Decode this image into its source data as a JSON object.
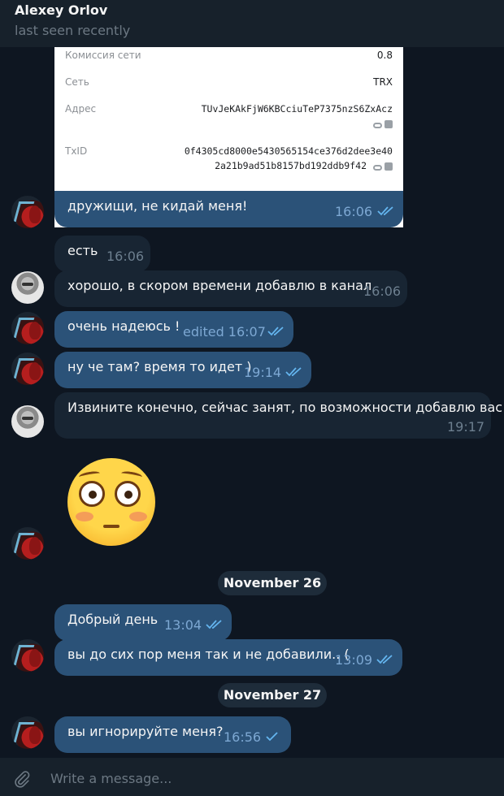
{
  "header": {
    "name": "Alexey Orlov",
    "status": "last seen recently"
  },
  "card": {
    "rows": [
      {
        "label": "Комиссия сети",
        "value": "0.8"
      },
      {
        "label": "Сеть",
        "value": "TRX"
      },
      {
        "label": "Адрес",
        "value": "TUvJeKAkFjW6KBCciuTeP7375nzS6ZxAcz"
      },
      {
        "label": "TxID",
        "value_line1": "0f4305cd8000e5430565154ce376d2dee3e40",
        "value_line2": "2a21b9ad51b8157bd192ddb9f42"
      }
    ]
  },
  "messages": [
    {
      "text": "дружищи, не кидай меня!",
      "time": "16:06",
      "dir": "out",
      "status": "read"
    },
    {
      "text": "есть",
      "time": "16:06",
      "dir": "in"
    },
    {
      "text": "хорошо, в скором времени добавлю в канал",
      "time": "16:06",
      "dir": "in"
    },
    {
      "text": "очень надеюсь !",
      "time": "edited 16:07",
      "dir": "out",
      "status": "read"
    },
    {
      "text": "ну че там? время то идет )",
      "time": "19:14",
      "dir": "out",
      "status": "read"
    },
    {
      "text": "Извините конечно, сейчас занят, по возможности добавлю вас",
      "time": "19:17",
      "dir": "in"
    },
    {
      "text": "Добрый день",
      "time": "13:04",
      "dir": "out",
      "status": "read"
    },
    {
      "text": "вы до сих пор меня так и не добавили.. (",
      "time": "13:09",
      "dir": "out",
      "status": "read"
    },
    {
      "text": "вы игнорируйте меня?",
      "time": "16:56",
      "dir": "out",
      "status": "sent"
    }
  ],
  "emoji_message": {
    "emoji_name": "flushed-face-emoji"
  },
  "dates": [
    "November 26",
    "November 27"
  ],
  "composer": {
    "placeholder": "Write a message..."
  },
  "colors": {
    "background": "#0e1621",
    "header": "#17212b",
    "outgoing": "#2b5278",
    "incoming": "#182533",
    "check": "#64b5ef"
  }
}
